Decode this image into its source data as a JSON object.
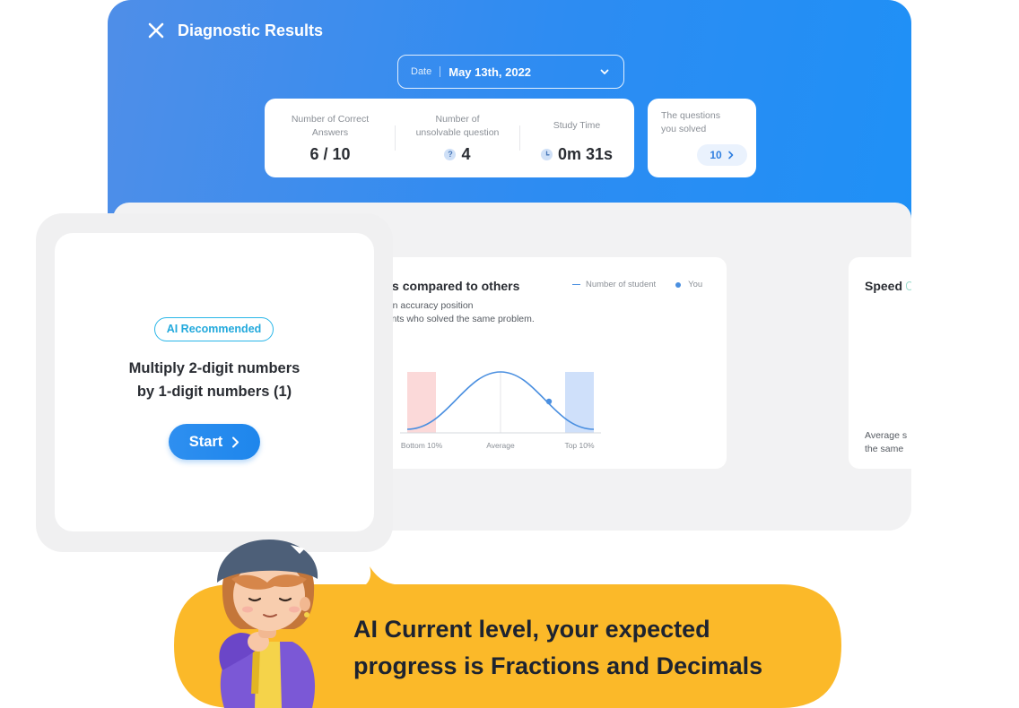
{
  "header": {
    "title": "Diagnostic Results",
    "close_icon": "close-icon"
  },
  "date_select": {
    "label": "Date",
    "value": "May 13th, 2022",
    "icon": "chevron-down-icon"
  },
  "stats": {
    "correct": {
      "label_line1": "Number of Correct",
      "label_line2": "Answers",
      "value": "6 / 10"
    },
    "unsolvable": {
      "label_line1": "Number of",
      "label_line2": "unsolvable question",
      "icon": "question-icon",
      "icon_glyph": "?",
      "value": "4"
    },
    "study_time": {
      "label": "Study Time",
      "icon": "clock-icon",
      "value": "0m 31s"
    }
  },
  "solved": {
    "label_line1": "The questions",
    "label_line2": "you solved",
    "count": "10",
    "icon": "chevron-right-icon"
  },
  "accuracy": {
    "title": "Accuracy results compared to others",
    "legend_students": "Number of student",
    "legend_you": "You",
    "desc_line1": "Indicates my calculation accuracy position",
    "desc_line2": "compared to the students who solved the same problem.",
    "label_bottom": "Bottom 10%",
    "label_average": "Average",
    "label_top": "Top 10%"
  },
  "speed": {
    "title": "Speed",
    "desc_line1": "Average s",
    "desc_line2": "the same"
  },
  "recommendation": {
    "badge": "AI Recommended",
    "title_line1": "Multiply 2-digit numbers",
    "title_line2": "by 1-digit numbers (1)",
    "start_label": "Start"
  },
  "bubble": {
    "line1": "AI Current level, your expected",
    "line2": "progress is Fractions and Decimals"
  },
  "colors": {
    "header_gradient_start": "#4f8ee8",
    "header_gradient_end": "#1f90f6",
    "accent_blue": "#2e8ff0",
    "badge_cyan": "#22a9dc",
    "bubble_yellow": "#fbb929",
    "bottom_band": "#fbd9d9",
    "top_band": "#cfe0fa"
  }
}
